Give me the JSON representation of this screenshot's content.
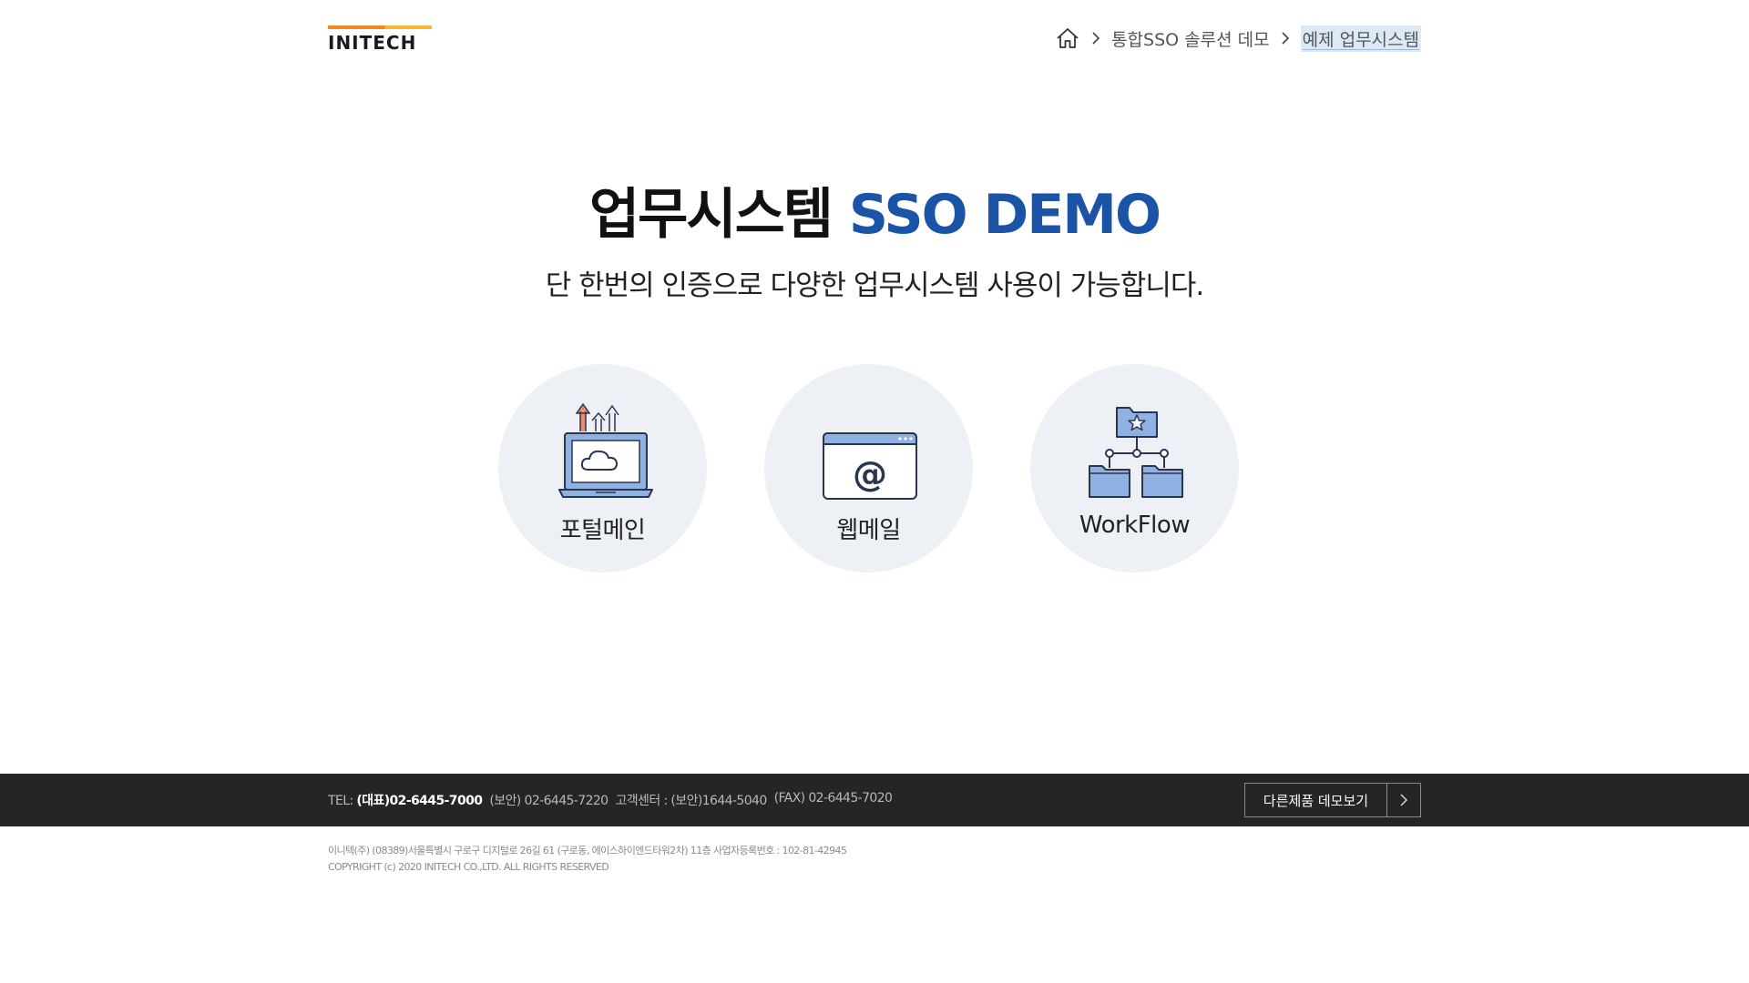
{
  "header": {
    "logo": "INITECH",
    "breadcrumb": {
      "item1": "통합SSO 솔루션 데모",
      "current": "예제 업무시스템"
    }
  },
  "hero": {
    "title_main": "업무시스템 ",
    "title_accent": "SSO DEMO",
    "subtitle": "단 한번의 인증으로 다양한 업무시스템 사용이 가능합니다."
  },
  "cards": [
    {
      "label": "포털메인",
      "icon": "portal-laptop-cloud-icon"
    },
    {
      "label": "웹메일",
      "icon": "webmail-at-icon"
    },
    {
      "label": "WorkFlow",
      "icon": "workflow-folder-tree-icon"
    }
  ],
  "footer": {
    "tel_label": "TEL:",
    "tel_main": "(대표)02-6445-7000",
    "tel_security": "(보안) 02-6445-7220",
    "customer_center": "고객센터 : (보안)1644-5040",
    "fax": "(FAX) 02-6445-7020",
    "demo_button": "다른제품 데모보기",
    "address": "이니텍(주) (08389)서울특별시 구로구 디지털로 26길 61 (구로동, 에이스하이엔드타워2차) 11층 사업자등록번호 : 102-81-42945",
    "copyright": "COPYRIGHT (c) 2020 INITECH CO.,LTD. ALL RIGHTS RESERVED"
  },
  "colors": {
    "accent": "#1b54a6",
    "card_bg": "#edf1f6",
    "footer_bg": "#252525",
    "logo_orange": "#f08a1c"
  }
}
